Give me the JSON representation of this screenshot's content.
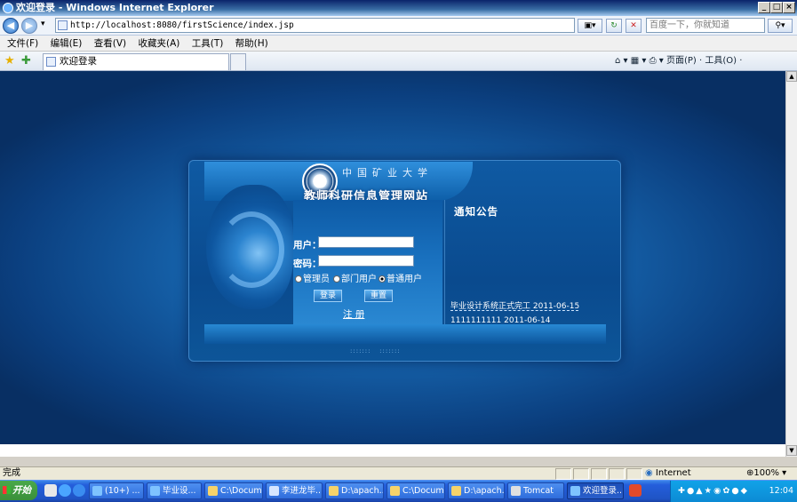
{
  "window": {
    "title": "欢迎登录 - Windows Internet Explorer",
    "controls": [
      "_",
      "□",
      "×"
    ]
  },
  "address": {
    "url": "http://localhost:8080/firstScience/index.jsp",
    "search_placeholder": "百度一下，你就知道"
  },
  "menubar": [
    "文件(F)",
    "编辑(E)",
    "查看(V)",
    "收藏夹(A)",
    "工具(T)",
    "帮助(H)"
  ],
  "tab": {
    "title": "欢迎登录"
  },
  "toolbar_right": "页面(P) · 工具(O) ·",
  "page": {
    "university": "中国矿业大学",
    "site_title": "教师科研信息管理网站",
    "form": {
      "user_label": "用户：",
      "password_label": "密码：",
      "roles": [
        {
          "label": "管理员",
          "checked": false
        },
        {
          "label": "部门用户",
          "checked": false
        },
        {
          "label": "普通用户",
          "checked": true
        }
      ],
      "login": "登录",
      "reset": "重置",
      "register": "注 册"
    },
    "notice": {
      "title": "通知公告",
      "items": [
        "毕业设计系统正式完工 2011-06-15",
        "1111111111 2011-06-14"
      ]
    }
  },
  "status": {
    "left": "完成",
    "zone": "Internet",
    "zoom": "100%"
  },
  "taskbar": {
    "start": "开始",
    "tasks": [
      "(10+) ...",
      "毕业设...",
      "C:\\Docum...",
      "李进龙毕...",
      "D:\\apach...",
      "C:\\Docum...",
      "D:\\apach...",
      "Tomcat",
      "欢迎登录..."
    ],
    "clock": "12:04"
  }
}
